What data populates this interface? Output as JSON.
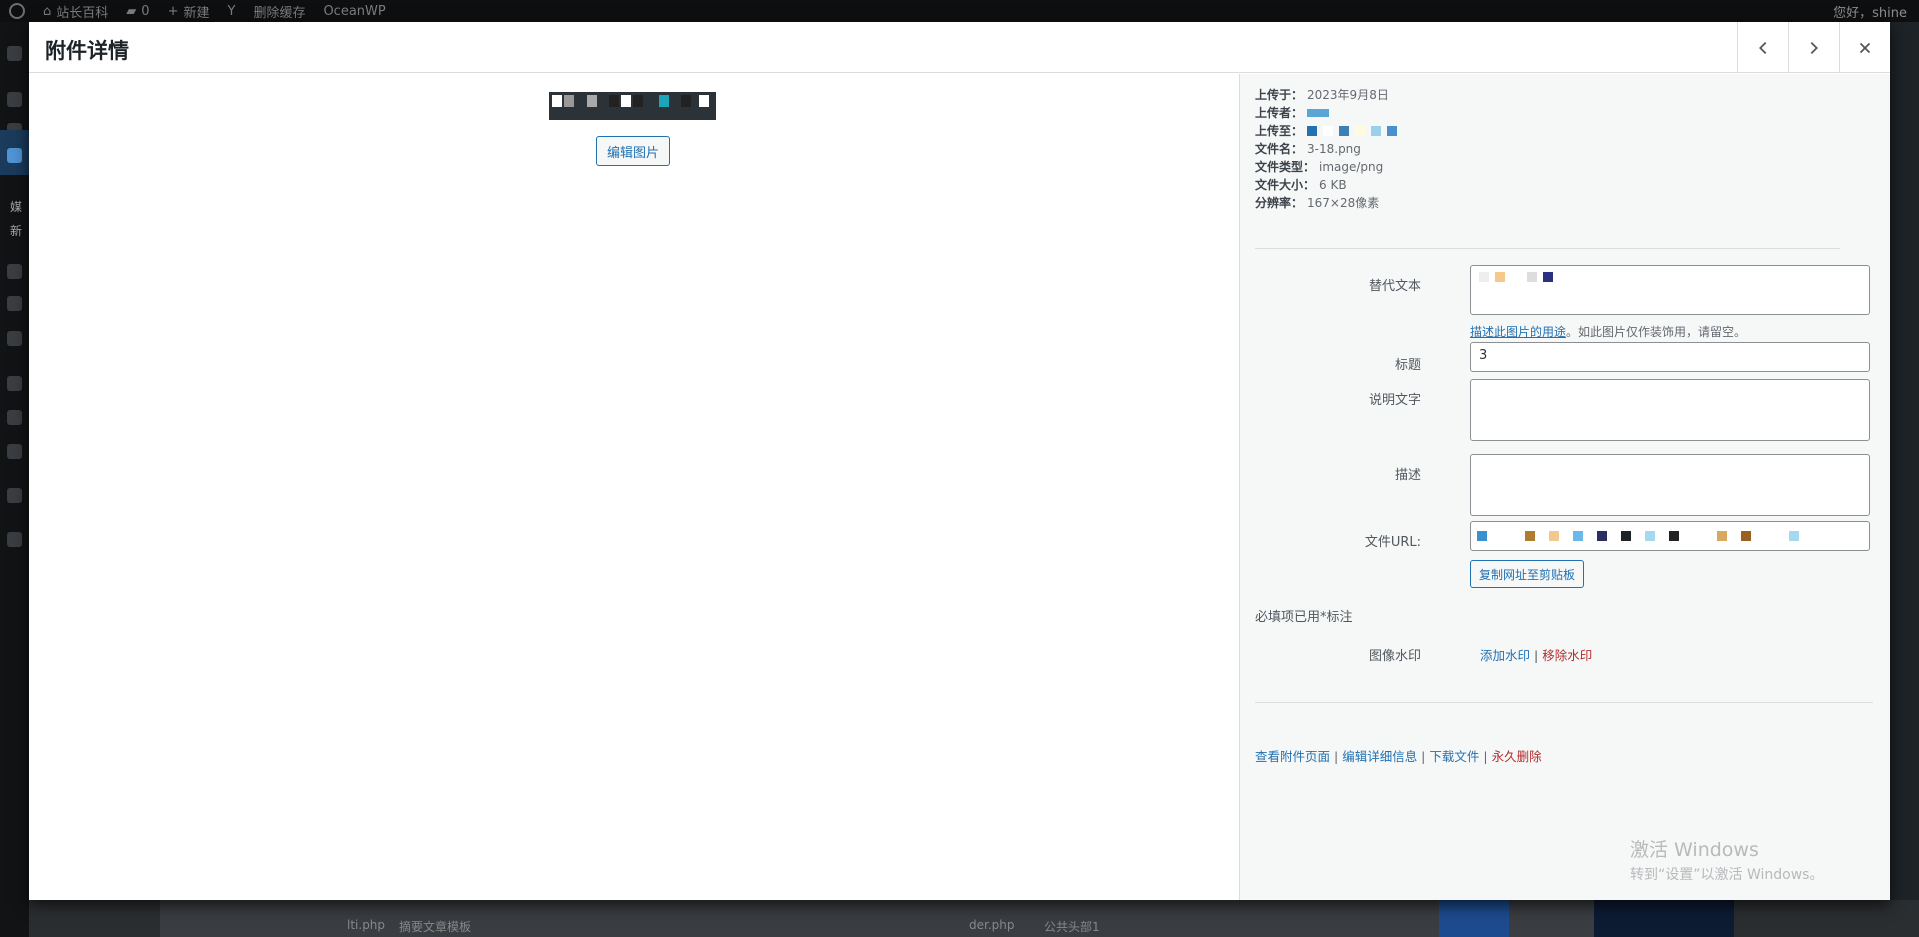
{
  "adminbar": {
    "site_name": "站长百科",
    "comments_count": "0",
    "new_label": "新建",
    "clear_cache": "删除缓存",
    "theme": "OceanWP",
    "greeting": "您好，shine"
  },
  "sidebar": {
    "media_label": "媒",
    "new_label": "新"
  },
  "modal": {
    "title": "附件详情",
    "prev_label": "上一个",
    "next_label": "下一个",
    "close_label": "关闭"
  },
  "media": {
    "edit_image_label": "编辑图片"
  },
  "meta": {
    "uploaded_on_label": "上传于：",
    "uploaded_on": "2023年9月8日",
    "uploaded_by_label": "上传者：",
    "uploaded_to_label": "上传至：",
    "file_name_label": "文件名：",
    "file_name": "3-18.png",
    "file_type_label": "文件类型：",
    "file_type": "image/png",
    "file_size_label": "文件大小：",
    "file_size": "6 KB",
    "dimensions_label": "分辨率：",
    "dimensions": "167×28像素"
  },
  "fields": {
    "alt_label": "替代文本",
    "alt_help_link": "描述此图片的用途",
    "alt_help_text": "。如此图片仅作装饰用，请留空。",
    "title_label": "标题",
    "title_value": "3",
    "caption_label": "说明文字",
    "caption_value": "",
    "description_label": "描述",
    "description_value": "",
    "url_label": "文件URL:",
    "copy_url_label": "复制网址至剪贴板",
    "required_note": "必填项已用*标注",
    "watermark_label": "图像水印",
    "add_watermark": "添加水印",
    "watermark_sep": " | ",
    "remove_watermark": "移除水印"
  },
  "actions": {
    "view_page": "查看附件页面",
    "sep1": " | ",
    "edit_details": "编辑详细信息",
    "sep2": " | ",
    "download": "下载文件",
    "sep3": " | ",
    "delete": "永久删除"
  },
  "os_watermark": {
    "title": "激活 Windows",
    "subtitle": "转到“设置”以激活 Windows。"
  },
  "backdrop": {
    "text1": "lti.php",
    "text2": "摘要文章模板",
    "text3": "der.php",
    "text4": "公共头部1"
  }
}
